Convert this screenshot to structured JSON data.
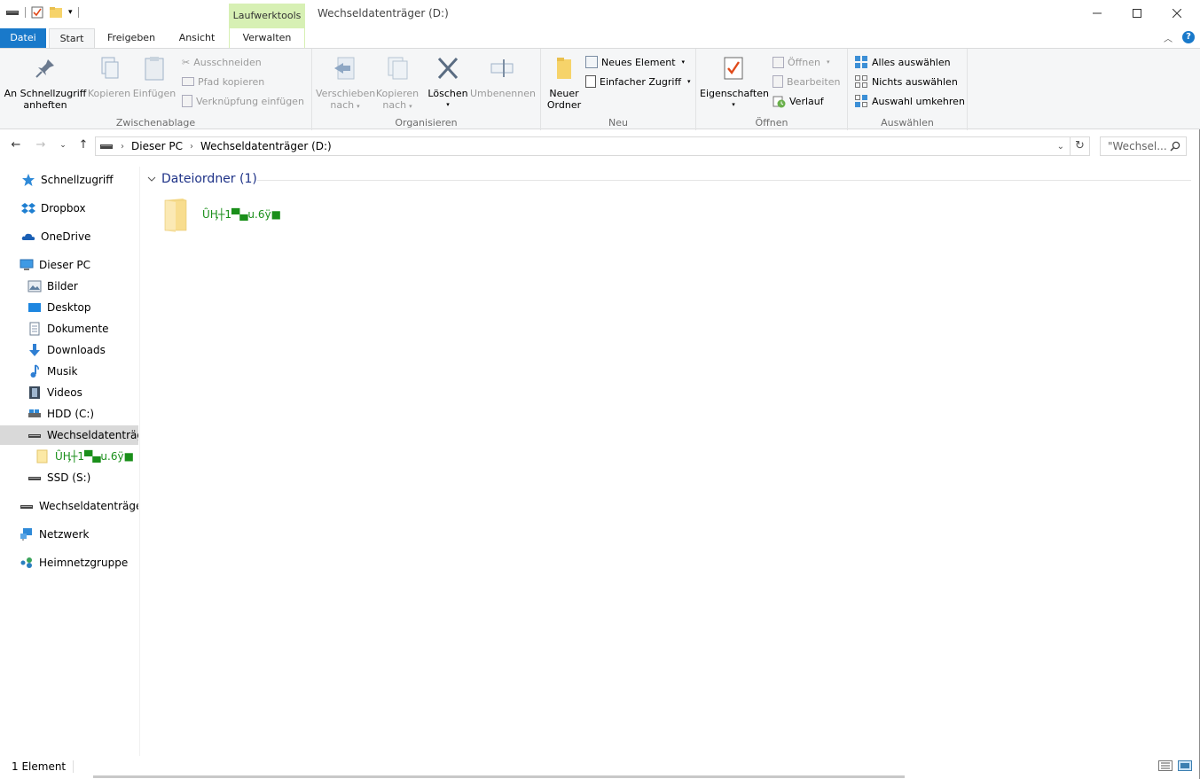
{
  "window": {
    "title": "Wechseldatenträger (D:)",
    "contextual_tab": "Laufwerktools"
  },
  "tabs": {
    "file": "Datei",
    "start": "Start",
    "share": "Freigeben",
    "view": "Ansicht",
    "manage": "Verwalten"
  },
  "ribbon": {
    "clipboard": {
      "label": "Zwischenablage",
      "pin_line1": "An Schnellzugriff",
      "pin_line2": "anheften",
      "copy": "Kopieren",
      "paste": "Einfügen",
      "cut": "Ausschneiden",
      "copy_path": "Pfad kopieren",
      "paste_shortcut": "Verknüpfung einfügen"
    },
    "organize": {
      "label": "Organisieren",
      "move_line1": "Verschieben",
      "move_line2": "nach",
      "copyto_line1": "Kopieren",
      "copyto_line2": "nach",
      "delete": "Löschen",
      "rename": "Umbenennen"
    },
    "new": {
      "label": "Neu",
      "folder_line1": "Neuer",
      "folder_line2": "Ordner",
      "new_item": "Neues Element",
      "easy_access": "Einfacher Zugriff"
    },
    "open": {
      "label": "Öffnen",
      "properties": "Eigenschaften",
      "open": "Öffnen",
      "edit": "Bearbeiten",
      "history": "Verlauf"
    },
    "select": {
      "label": "Auswählen",
      "select_all": "Alles auswählen",
      "select_none": "Nichts auswählen",
      "invert": "Auswahl umkehren"
    }
  },
  "address": {
    "crumbs": [
      "Dieser PC",
      "Wechseldatenträger (D:)"
    ],
    "search_placeholder": "\"Wechsel..."
  },
  "nav": {
    "quick_access": "Schnellzugriff",
    "dropbox": "Dropbox",
    "onedrive": "OneDrive",
    "this_pc": "Dieser PC",
    "pictures": "Bilder",
    "desktop": "Desktop",
    "documents": "Dokumente",
    "downloads": "Downloads",
    "music": "Musik",
    "videos": "Videos",
    "hdd": "HDD (C:)",
    "removable": "Wechseldatenträger",
    "garbled_folder": "ȖӉ┼1▀▄u.6ÿ■",
    "ssd": "SSD (S:)",
    "removable2": "Wechseldatenträger (",
    "network": "Netzwerk",
    "homegroup": "Heimnetzgruppe"
  },
  "content": {
    "group_header": "Dateiordner (1)",
    "folder_name": "ȖӉ┼1▀▄u.6ÿ■"
  },
  "status": {
    "count": "1 Element"
  },
  "colors": {
    "file_tab": "#1979ca",
    "context_tab": "#d7f0b4",
    "garbled_text": "#1a8f1a",
    "group_header": "#1e3287",
    "selection": "#d9d9d9"
  }
}
